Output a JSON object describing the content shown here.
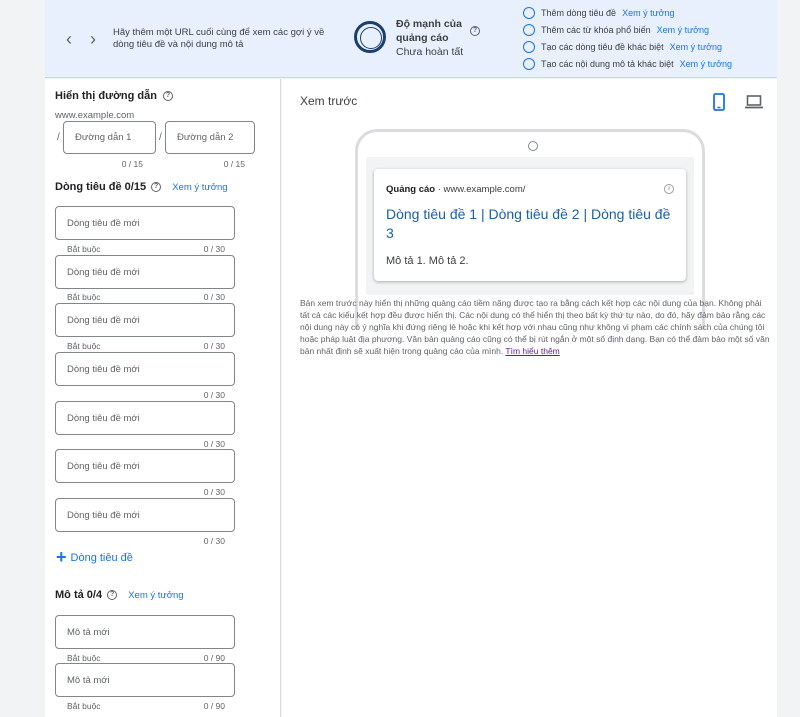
{
  "topbar": {
    "hint": "Hãy thêm một URL cuối cùng để xem các gợi ý về dòng tiêu đề và nội dung mô tả",
    "strength": {
      "title": "Độ mạnh của quảng cáo",
      "status": "Chưa hoàn tất"
    },
    "suggestions": [
      {
        "label": "Thêm dòng tiêu đề",
        "link": "Xem ý tưởng"
      },
      {
        "label": "Thêm các từ khóa phổ biến",
        "link": "Xem ý tưởng"
      },
      {
        "label": "Tạo các dòng tiêu đề khác biệt",
        "link": "Xem ý tưởng"
      },
      {
        "label": "Tạo các nội dung mô tả khác biệt",
        "link": "Xem ý tưởng"
      }
    ]
  },
  "left": {
    "path": {
      "title": "Hiển thị đường dẫn",
      "domain": "www.example.com",
      "separator": "/",
      "field1": {
        "placeholder": "Đường dẫn 1",
        "counter": "0 / 15"
      },
      "field2": {
        "placeholder": "Đường dẫn 2",
        "counter": "0 / 15"
      }
    },
    "headlines": {
      "title": "Dòng tiêu đề 0/15",
      "ideas": "Xem ý tưởng",
      "required": "Bắt buộc",
      "items": [
        {
          "placeholder": "Dòng tiêu đề mới",
          "counter": "0 / 30"
        },
        {
          "placeholder": "Dòng tiêu đề mới",
          "counter": "0 / 30"
        },
        {
          "placeholder": "Dòng tiêu đề mới",
          "counter": "0 / 30"
        },
        {
          "placeholder": "Dòng tiêu đề mới",
          "counter": "0 / 30"
        },
        {
          "placeholder": "Dòng tiêu đề mới",
          "counter": "0 / 30"
        },
        {
          "placeholder": "Dòng tiêu đề mới",
          "counter": "0 / 30"
        },
        {
          "placeholder": "Dòng tiêu đề mới",
          "counter": "0 / 30"
        }
      ],
      "add_label": "Dòng tiêu đề"
    },
    "descriptions": {
      "title": "Mô tả 0/4",
      "ideas": "Xem ý tưởng",
      "required": "Bắt buộc",
      "items": [
        {
          "placeholder": "Mô tả mới",
          "counter": "0 / 90"
        },
        {
          "placeholder": "Mô tả mới",
          "counter": "0 / 90"
        }
      ]
    }
  },
  "preview": {
    "title": "Xem trước",
    "ad": {
      "label": "Quảng cáo",
      "url": "www.example.com/",
      "headline": "Dòng tiêu đề 1 | Dòng tiêu đề 2 | Dòng tiêu đề 3",
      "description": "Mô tả 1. Mô tả 2."
    },
    "disclaimer": "Bản xem trước này hiển thị những quảng cáo tiềm năng được tạo ra bằng cách kết hợp các nội dung của bạn. Không phải tất cả các kiểu kết hợp đều được hiển thị. Các nội dung có thể hiển thị theo bất kỳ thứ tự nào, do đó, hãy đảm bảo rằng các nội dung này có ý nghĩa khi đứng riêng lẻ hoặc khi kết hợp với nhau cũng như không vi phạm các chính sách của chúng tôi hoặc pháp luật địa phương. Văn bản quảng cáo cũng có thể bị rút ngắn ở một số định dạng. Bạn có thể đảm bảo một số văn bản nhất định sẽ xuất hiện trong quảng cáo của mình.",
    "learn_more": "Tìm hiểu thêm"
  }
}
